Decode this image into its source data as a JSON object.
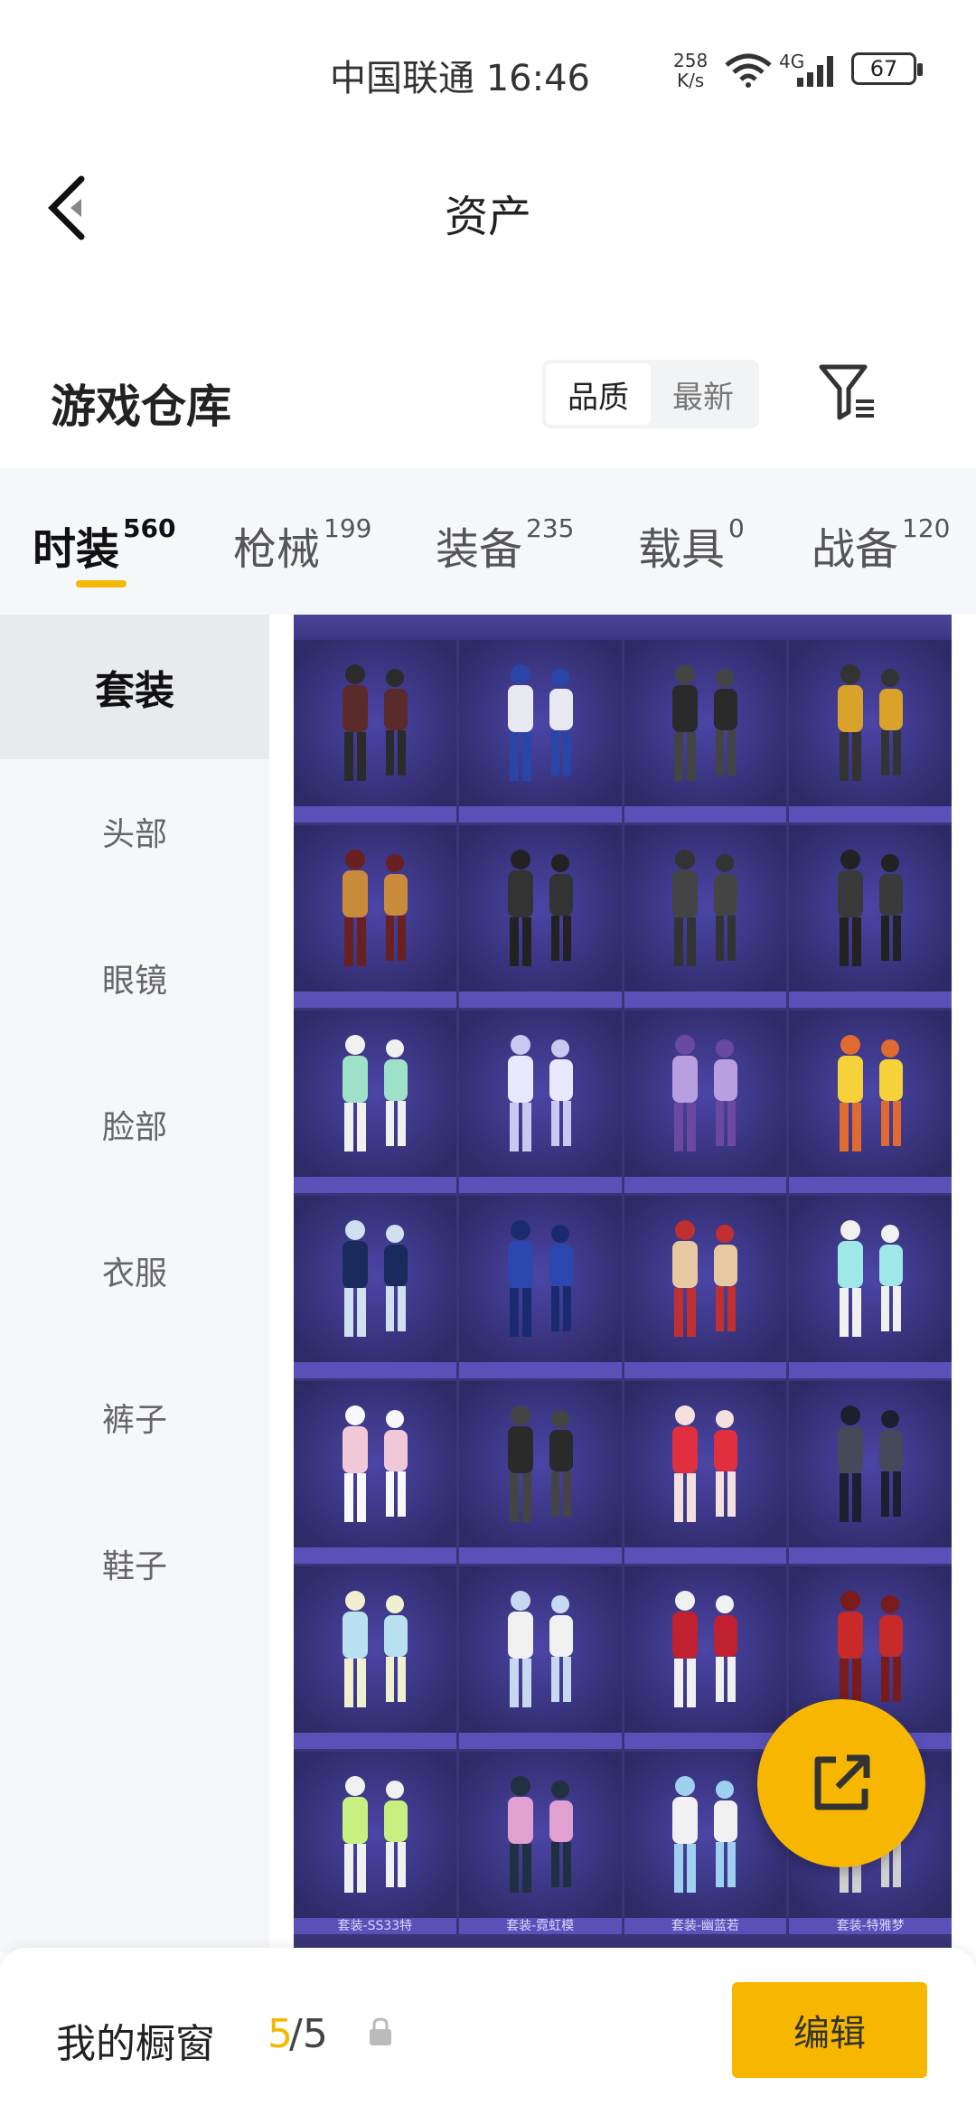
{
  "status_bar": {
    "carrier_time": "中国联通 16:46",
    "speed_value": "258",
    "speed_unit": "K/s",
    "network": "4G",
    "battery": "67"
  },
  "header": {
    "title": "资产"
  },
  "section": {
    "title": "游戏仓库",
    "sort_quality": "品质",
    "sort_newest": "最新"
  },
  "tabs": [
    {
      "label": "时装",
      "count": "560"
    },
    {
      "label": "枪械",
      "count": "199"
    },
    {
      "label": "装备",
      "count": "235"
    },
    {
      "label": "载具",
      "count": "0"
    },
    {
      "label": "战备",
      "count": "120"
    }
  ],
  "sidebar": [
    {
      "label": "套装"
    },
    {
      "label": "头部"
    },
    {
      "label": "眼镜"
    },
    {
      "label": "脸部"
    },
    {
      "label": "衣服"
    },
    {
      "label": "裤子"
    },
    {
      "label": "鞋子"
    }
  ],
  "grid_bottom_labels": [
    "套装-SS33特",
    "套装-霓虹模",
    "套装-幽蓝若",
    "套装-特雅梦"
  ],
  "bottom_bar": {
    "label": "我的橱窗",
    "count": "5",
    "total": "/5",
    "edit_button": "编辑"
  },
  "colors": {
    "accent": "#f7b700",
    "grid_bg": "#3a3478",
    "tab_bg": "#f5f7fa"
  }
}
